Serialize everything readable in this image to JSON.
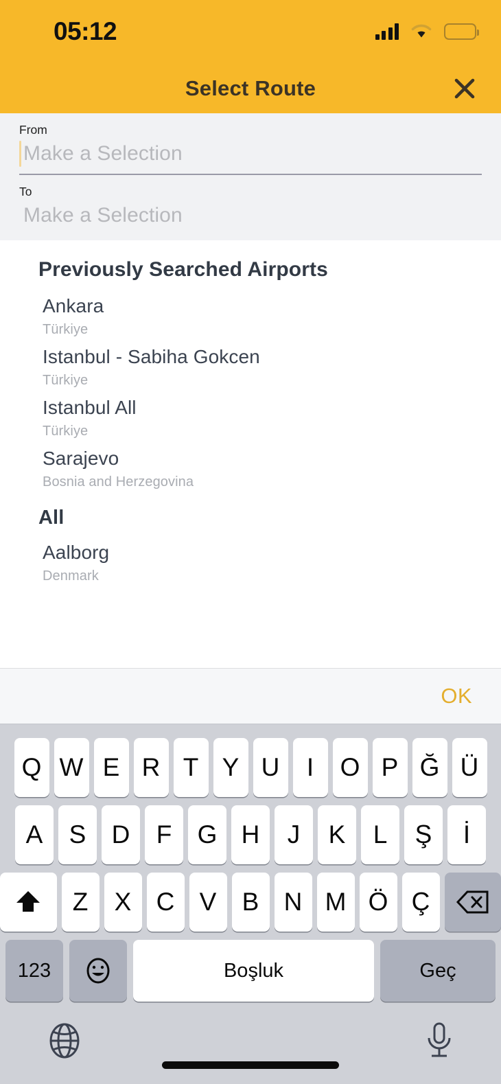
{
  "statusbar": {
    "time": "05:12",
    "signal_icon": "signal-bars-icon",
    "wifi_icon": "wifi-icon",
    "battery_icon": "battery-icon"
  },
  "header": {
    "title": "Select Route",
    "close_icon": "close-icon",
    "background_color": "#f7b829",
    "title_color": "#3b3326"
  },
  "form": {
    "from": {
      "label": "From",
      "value": "",
      "placeholder": "Make a Selection",
      "focused": true
    },
    "to": {
      "label": "To",
      "value": "",
      "placeholder": "Make a Selection",
      "focused": false
    }
  },
  "list": {
    "sections": [
      {
        "title": "Previously Searched Airports",
        "items": [
          {
            "city": "Ankara",
            "country": "Türkiye"
          },
          {
            "city": "Istanbul - Sabiha Gokcen",
            "country": "Türkiye"
          },
          {
            "city": "Istanbul All",
            "country": "Türkiye"
          },
          {
            "city": "Sarajevo",
            "country": "Bosnia and Herzegovina"
          }
        ]
      },
      {
        "title": "All",
        "items": [
          {
            "city": "Aalborg",
            "country": "Denmark"
          }
        ]
      }
    ]
  },
  "accessory": {
    "ok_label": "OK",
    "ok_color": "#e4ae2e"
  },
  "keyboard": {
    "language": "Turkish",
    "row1": [
      "Q",
      "W",
      "E",
      "R",
      "T",
      "Y",
      "U",
      "I",
      "O",
      "P",
      "Ğ",
      "Ü"
    ],
    "row2": [
      "A",
      "S",
      "D",
      "F",
      "G",
      "H",
      "J",
      "K",
      "L",
      "Ş",
      "İ"
    ],
    "row3": [
      "Z",
      "X",
      "C",
      "V",
      "B",
      "N",
      "M",
      "Ö",
      "Ç"
    ],
    "shift_icon": "shift-icon",
    "backspace_icon": "backspace-icon",
    "numbers_label": "123",
    "emoji_icon": "emoji-icon",
    "space_label": "Boşluk",
    "go_label": "Geç",
    "globe_icon": "globe-icon",
    "mic_icon": "microphone-icon"
  }
}
